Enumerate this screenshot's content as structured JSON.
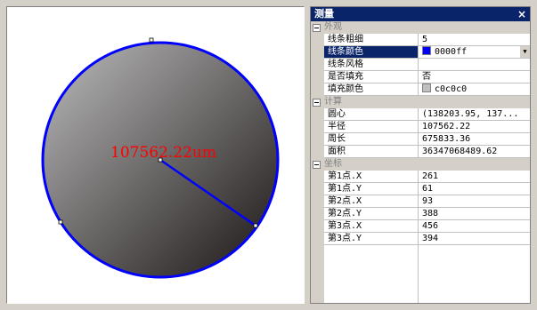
{
  "canvas": {
    "measurement_label": "107562.22um",
    "label_color": "#ff0000",
    "circle_stroke_color": "#0000ff",
    "circle_fill_gradient": [
      "#bdbdbd",
      "#1a1414"
    ]
  },
  "panel": {
    "title": "测量",
    "close_glyph": "×",
    "title_bg": "#0a246a",
    "categories": [
      {
        "label": "外观",
        "props": [
          {
            "name": "线条粗细",
            "value": "5"
          },
          {
            "name": "线条颜色",
            "value": "0000ff",
            "swatch": "#0000ff",
            "selected": true,
            "dropdown": true
          },
          {
            "name": "线条风格",
            "value": ""
          },
          {
            "name": "是否填充",
            "value": "否"
          },
          {
            "name": "填充颜色",
            "value": "c0c0c0",
            "swatch": "#c0c0c0"
          }
        ]
      },
      {
        "label": "计算",
        "props": [
          {
            "name": "圆心",
            "value": "(138203.95, 137..."
          },
          {
            "name": "半径",
            "value": "107562.22"
          },
          {
            "name": "周长",
            "value": "675833.36"
          },
          {
            "name": "面积",
            "value": "36347068489.62"
          }
        ]
      },
      {
        "label": "坐标",
        "props": [
          {
            "name": "第1点.X",
            "value": "261"
          },
          {
            "name": "第1点.Y",
            "value": "61"
          },
          {
            "name": "第2点.X",
            "value": "93"
          },
          {
            "name": "第2点.Y",
            "value": "388"
          },
          {
            "name": "第3点.X",
            "value": "456"
          },
          {
            "name": "第3点.Y",
            "value": "394"
          }
        ]
      }
    ]
  }
}
